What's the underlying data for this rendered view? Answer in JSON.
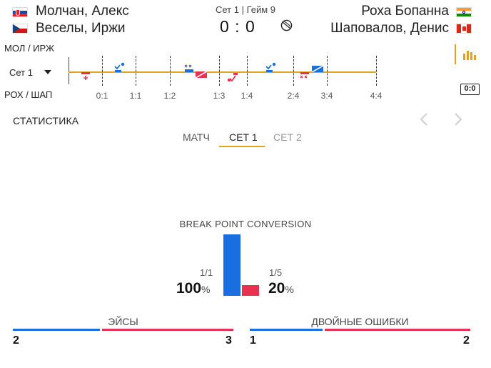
{
  "header": {
    "home_team_line1": "Молчан, Алекс",
    "home_team_line2": "Веселы, Иржи",
    "away_team_line1": "Роха Бопанна",
    "away_team_line2": "Шаповалов, Денис",
    "set_game": "Сет 1 | Гейм 9",
    "score": "0 : 0",
    "flags": [
      "slovakia",
      "czech-republic",
      "india",
      "canada"
    ]
  },
  "timeline": {
    "top_team": "МОЛ / ИРЖ",
    "bottom_team": "РОХ / ШАП",
    "set_selector": "Сет 1",
    "ticks": [
      "0:1",
      "1:1",
      "1:2",
      "1:3",
      "1:4",
      "2:4",
      "3:4",
      "4:4"
    ],
    "events": [
      "double-fault",
      "ace",
      "double-fault",
      "break",
      "ace",
      "ace",
      "double-fault",
      "break"
    ]
  },
  "side_icons": {
    "stats_icon": "bar-chart-icon",
    "scoreboard_label": "0:0"
  },
  "stats": {
    "title": "СТАТИСТИКА",
    "tabs": [
      "МАТЧ",
      "СЕТ 1",
      "СЕТ 2"
    ],
    "active_tab": "СЕТ 1"
  },
  "break_point": {
    "title": "BREAK POINT CONVERSION",
    "home_fraction": "1/1",
    "home_pct": "100",
    "away_fraction": "1/5",
    "away_pct": "20",
    "unit": "%",
    "home_value": 1.0,
    "away_value": 0.2
  },
  "comparisons": [
    {
      "label": "ЭЙСЫ",
      "home": "2",
      "away": "3"
    },
    {
      "label": "ДВОЙНЫЕ ОШИБКИ",
      "home": "1",
      "away": "2"
    }
  ],
  "colors": {
    "home": "#1a6fe0",
    "away": "#e8314f",
    "accent": "#e2a11f"
  }
}
